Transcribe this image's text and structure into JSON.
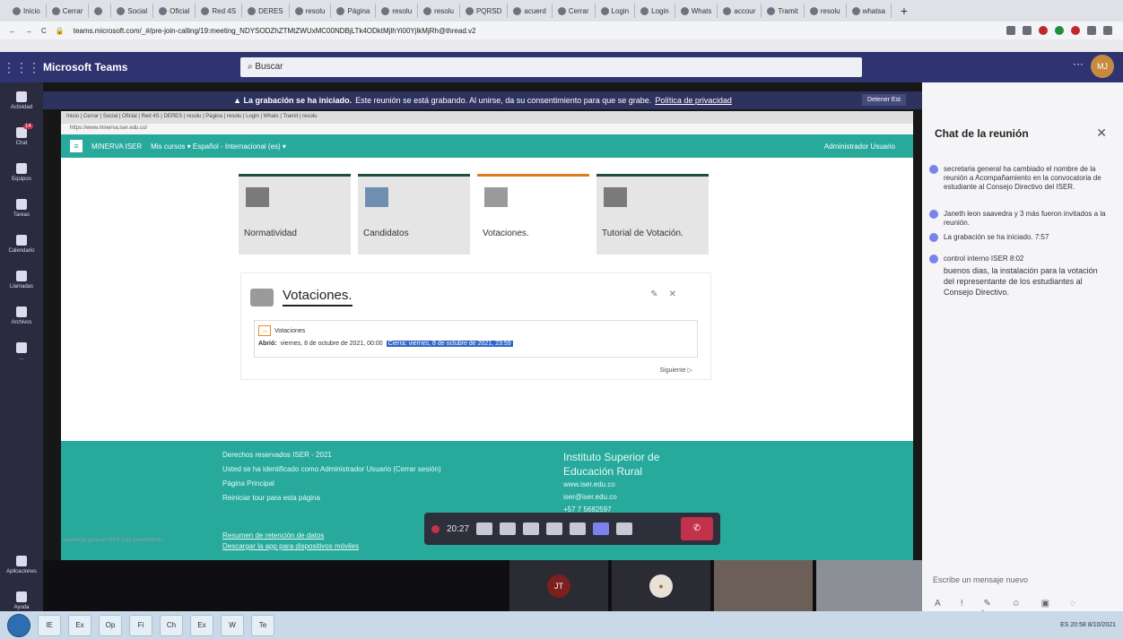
{
  "browser": {
    "tabs": [
      "Inicio",
      "Cerrar",
      "",
      "Social",
      "Oficial",
      "Red 4S",
      "DERES",
      "resolu",
      "Página",
      "resolu",
      "resolu",
      "PQRSD",
      "acuerd",
      "Cerrar",
      "Login",
      "Login",
      "Whats",
      "accour",
      "Tramit",
      "resolu",
      "whatsa"
    ],
    "new_tab": "+",
    "url": "teams.microsoft.com/_#/pre-join-calling/19:meeting_NDYSODZhZTMtZWUxMC00NDBjLTk4ODktMjlhYi00YjlkMjRh@thread.v2"
  },
  "teams": {
    "brand": "Microsoft Teams",
    "search_placeholder": "Buscar",
    "user_initials": "MJ",
    "rail": [
      "Actividad",
      "Chat",
      "Equipos",
      "Tareas",
      "Calendario",
      "Llamadas",
      "Archivos",
      "...",
      "Aplicaciones",
      "Ayuda"
    ],
    "chat_badge": "14"
  },
  "banner": {
    "bold": "La grabación se ha iniciado.",
    "text": "Este reunión se está grabando. Al unirse, da su consentimiento para que se grabe.",
    "link": "Política de privacidad",
    "stop": "Detener Est"
  },
  "shared": {
    "inner_tabs": "Inicio | Cerrar | Social | Oficial | Red 4S | DERES | resolu | Página | resolu | Login | Whats | Tramit | resolu",
    "inner_url": "https://www.minerva.iser.edu.co/",
    "brand": "MINERVA ISER",
    "nav": "Mis cursos ▾   Español - Internacional (es) ▾",
    "admin": "Administrador Usuario",
    "cards": [
      {
        "label": "Normatividad"
      },
      {
        "label": "Candidatos"
      },
      {
        "label": "Votaciones."
      },
      {
        "label": "Tutorial de Votación."
      }
    ],
    "panel_title": "Votaciones.",
    "activity": "Votaciones",
    "open_label": "Abrió:",
    "open_value": "viernes, 8 de octubre de 2021, 00:00",
    "close_highlight": "Cierra: viernes, 8 de octubre de 2021, 23:59",
    "next": "Siguiente ▷",
    "footer_left": [
      "Usted se ha identificado como Administrador Usuario (Cerrar sesión)",
      "Página Principal",
      "Reiniciar tour para esta página"
    ],
    "footer_top": "Derechos reservados ISER - 2021",
    "footer_inst": [
      "Instituto Superior de",
      "Educación Rural"
    ],
    "footer_contact": [
      "www.iser.edu.co",
      "iser@iser.edu.co",
      "+57 7 5682597"
    ],
    "footer_bottom": [
      "Resumen de retención de datos",
      "Descargar la app para dispositivos móviles"
    ],
    "share_name": "secretaria general ISER está presentando"
  },
  "callbar": {
    "timer": "20:27",
    "hang": "✆"
  },
  "tiles": {
    "a1": "JT"
  },
  "chat": {
    "title": "Chat de la reunión",
    "messages": [
      "secretaria general ha cambiado el nombre de la reunión a Acompañamiento en la convocatoria de estudiante al Consejo Directivo del ISER.",
      "Janeth leon saavedra y 3 más fueron invitados a la reunión.",
      "La grabación se ha iniciado.   7:57",
      "control interno ISER   8:02",
      "buenos dias, la instalación para la votación del representante de los estudiantes al Consejo Directivo."
    ],
    "compose": "Escribe un mensaje nuevo",
    "tools": "A ! ✎ ☺ ▣ ◌ ···  ▷"
  },
  "taskbar": {
    "apps": [
      "IE",
      "Ex",
      "Op",
      "Fi",
      "Ch",
      "Ex",
      "W",
      "Te"
    ],
    "tray": "ES  20:58  8/10/2021"
  }
}
